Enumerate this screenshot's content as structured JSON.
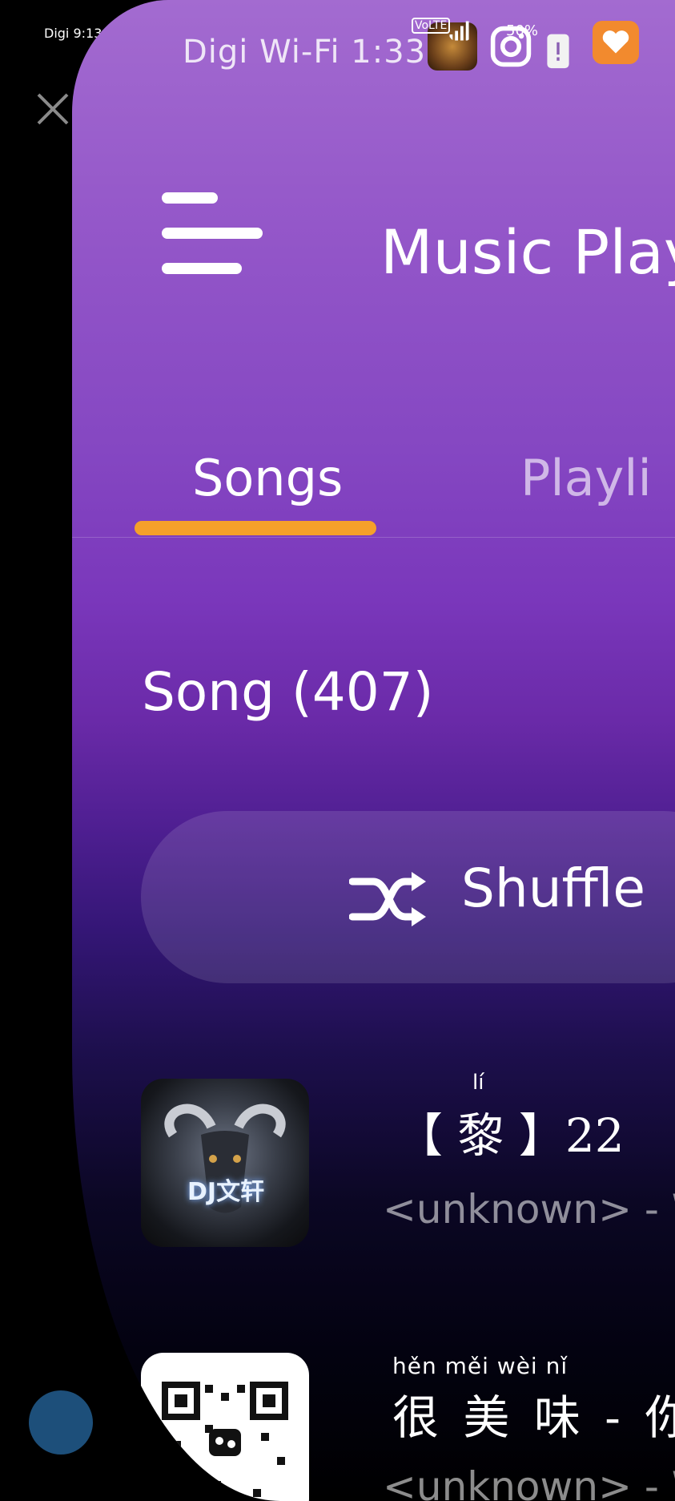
{
  "outer_status": {
    "carrier_time": "Digi 9:13"
  },
  "status_bar": {
    "network_time": "Digi Wi-Fi 1:33",
    "battery": "50%",
    "volte_badge": "VoLTE",
    "icons": [
      "game-app-icon",
      "instagram-icon",
      "signal-icon",
      "battery-icon",
      "heart-app-icon"
    ]
  },
  "header": {
    "title": "Music Play"
  },
  "tabs": [
    {
      "label": "Songs",
      "active": true
    },
    {
      "label": "Playli",
      "active": false
    }
  ],
  "colors": {
    "accent": "#f5a02a",
    "window_top": "#a36bd0",
    "window_mid": "#6a2aa8",
    "window_bottom": "#000000"
  },
  "library": {
    "count_label": "Song (407)"
  },
  "shuffle": {
    "label": "Shuffle"
  },
  "songs": [
    {
      "pinyin": "lí",
      "title": "【 黎 】22",
      "subtitle": "<unknown> - W",
      "thumb_text": "DJ文轩"
    },
    {
      "pinyin": "hěn   měi   wèi         nǐ",
      "title": "很 美 味 - 你",
      "subtitle": "<unknown> - W"
    }
  ]
}
